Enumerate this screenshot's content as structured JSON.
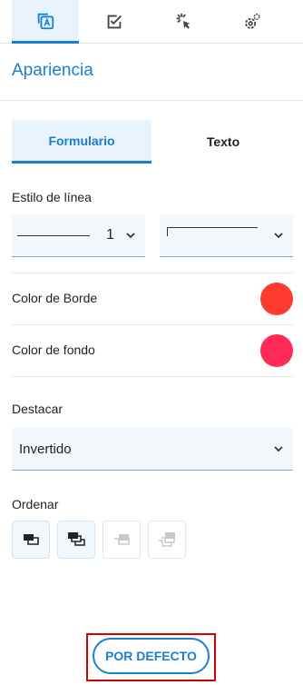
{
  "top_tabs": [
    {
      "icon": "appearance-icon",
      "active": true
    },
    {
      "icon": "checkbox-icon",
      "active": false
    },
    {
      "icon": "click-icon",
      "active": false
    },
    {
      "icon": "gear-icon",
      "active": false
    }
  ],
  "section_title": "Apariencia",
  "sub_tabs": {
    "form": "Formulario",
    "text": "Texto"
  },
  "line_style": {
    "label": "Estilo de línea",
    "width_value": "1"
  },
  "border_color": {
    "label": "Color de Borde",
    "color": "#ff3b2f"
  },
  "background_color": {
    "label": "Color de fondo",
    "color": "#ff2a55"
  },
  "highlight": {
    "label": "Destacar",
    "value": "Invertido"
  },
  "order": {
    "label": "Ordenar",
    "buttons": [
      {
        "icon": "bring-forward-icon",
        "enabled": true
      },
      {
        "icon": "bring-to-front-icon",
        "enabled": true
      },
      {
        "icon": "send-backward-icon",
        "enabled": false
      },
      {
        "icon": "send-to-back-icon",
        "enabled": false
      }
    ]
  },
  "default_button": "POR DEFECTO",
  "colors": {
    "accent": "#1a7fd0",
    "tab_active_bg": "#e8f3fc",
    "highlight_frame": "#d40000"
  }
}
